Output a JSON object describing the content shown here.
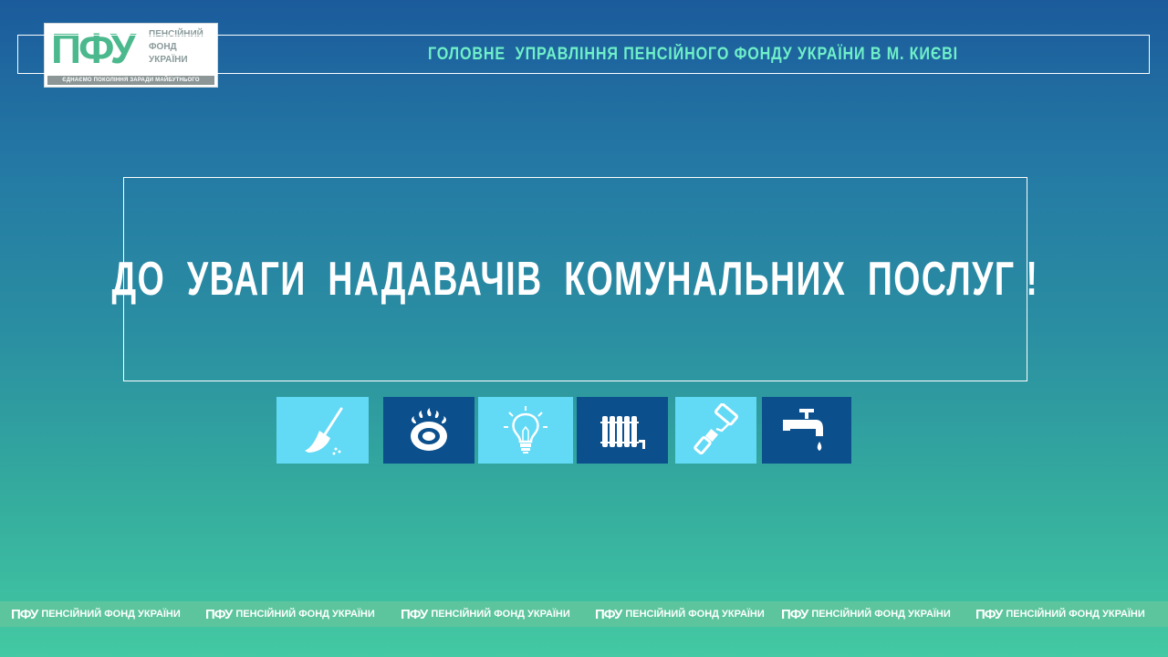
{
  "header": {
    "title": "ГОЛОВНЕ  УПРАВЛІННЯ ПЕНСІЙНОГО ФОНДУ УКРАЇНИ В М. КИЄВІ"
  },
  "logo": {
    "mark": "ПФУ",
    "line1": "ПЕНСІЙНИЙ",
    "line2": "ФОНД",
    "line3": "УКРАЇНИ",
    "tagline": "ЄДНАЄМО ПОКОЛІННЯ ЗАРАДИ МАЙБУТНЬОГО"
  },
  "main": {
    "title": "ДО  УВАГИ  НАДАВАЧІВ  КОМУНАЛЬНИХ  ПОСЛУГ !"
  },
  "icons": [
    {
      "name": "broom-icon",
      "style": "light"
    },
    {
      "name": "gas-burner-icon",
      "style": "dark"
    },
    {
      "name": "light-bulb-icon",
      "style": "light"
    },
    {
      "name": "radiator-icon",
      "style": "dark"
    },
    {
      "name": "paint-roller-icon",
      "style": "light"
    },
    {
      "name": "water-tap-icon",
      "style": "dark"
    }
  ],
  "footer": {
    "mark": "ПФУ",
    "text": "ПЕНСІЙНИЙ ФОНД УКРАЇНИ"
  },
  "colors": {
    "accent_text": "#6ff0c8",
    "tile_light": "#62d9f5",
    "tile_dark": "#0b4f8c",
    "logo_green": "#4bb98d"
  }
}
